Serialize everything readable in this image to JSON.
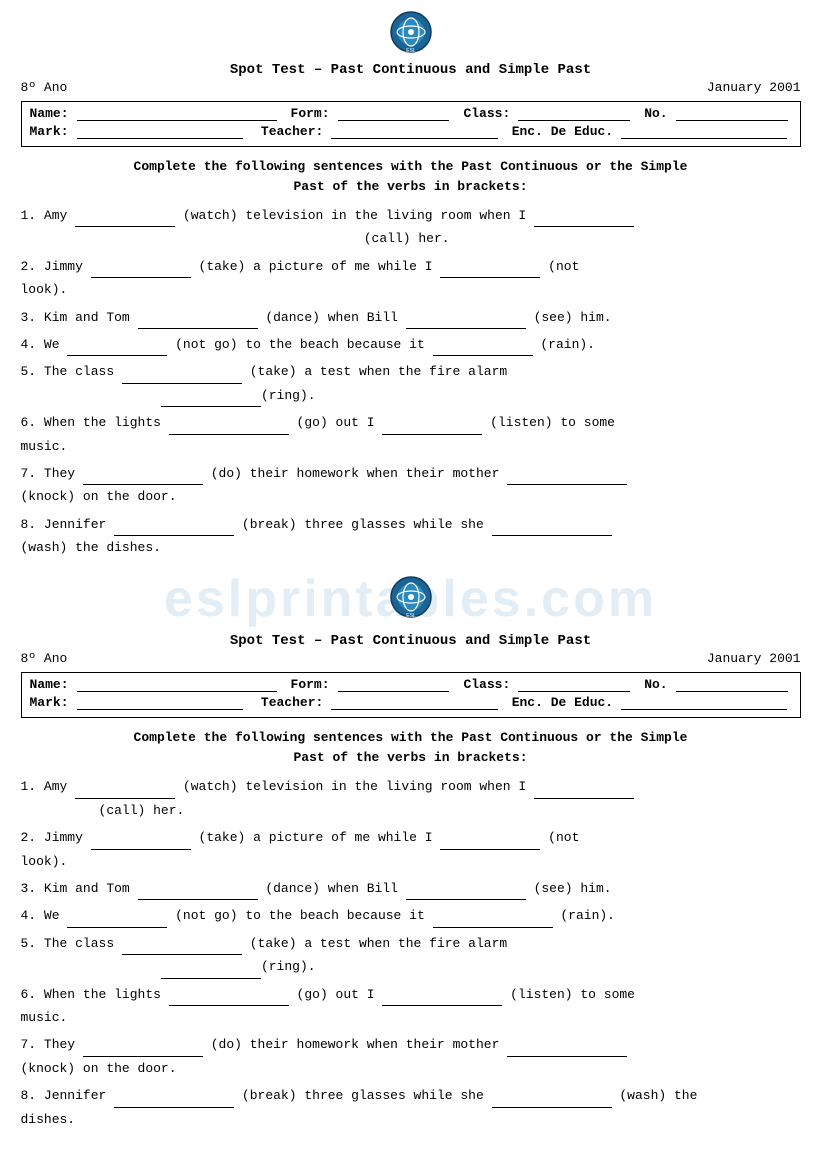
{
  "logo": {
    "alt": "ESL Printables Logo"
  },
  "section1": {
    "title": "Spot Test – Past Continuous and Simple Past",
    "grade": "8º Ano",
    "date": "January 2001",
    "form_labels": {
      "name": "Name:",
      "form": "Form:",
      "class": "Class:",
      "no": "No.",
      "mark": "Mark:",
      "teacher": "Teacher:",
      "enc": "Enc. De Educ."
    },
    "instructions": "Complete the following sentences with the Past Continuous or the Simple\nPast of the verbs in brackets:",
    "exercises": [
      {
        "num": "1.",
        "text_parts": [
          "Amy ",
          " (watch) television in the living room when I ",
          " (call) her."
        ],
        "blanks": 2
      },
      {
        "num": "2.",
        "text_parts": [
          "Jimmy ",
          " (take) a picture of me while I ",
          " (not look)."
        ],
        "blanks": 2
      },
      {
        "num": "3.",
        "text_parts": [
          "Kim and Tom ",
          " (dance) when Bill ",
          " (see) him."
        ],
        "blanks": 2
      },
      {
        "num": "4.",
        "text_parts": [
          "We ",
          " (not go) to the beach because it ",
          " (rain)."
        ],
        "blanks": 2
      },
      {
        "num": "5.",
        "text_parts": [
          "The  class ",
          " (take)  a  test  when  the  fire  alarm ",
          "(ring)."
        ],
        "blanks": 2
      },
      {
        "num": "6.",
        "text_parts": [
          "When the lights ",
          " (go) out I ",
          " (listen) to some music."
        ],
        "blanks": 2
      },
      {
        "num": "7.",
        "text_parts": [
          "They ",
          " (do) their homework when their mother ",
          " (knock) on the door."
        ],
        "blanks": 2
      },
      {
        "num": "8.",
        "text_parts": [
          "Jennifer ",
          " (break) three glasses while she ",
          " (wash) the dishes."
        ],
        "blanks": 2
      }
    ]
  },
  "section2": {
    "title": "Spot Test – Past Continuous and Simple Past",
    "grade": "8º Ano",
    "date": "January 2001",
    "instructions": "Complete the following sentences with the Past Continuous or the Simple\nPast of the verbs in brackets:",
    "exercises": [
      {
        "num": "1.",
        "text_parts": [
          "Amy ",
          " (watch) television in the living room when I ",
          " (call) her."
        ],
        "blanks": 2
      },
      {
        "num": "2.",
        "text_parts": [
          "Jimmy ",
          " (take) a picture of me while I ",
          " (not look)."
        ],
        "blanks": 2
      },
      {
        "num": "3.",
        "text_parts": [
          "Kim and Tom ",
          " (dance) when Bill ",
          " (see) him."
        ],
        "blanks": 2
      },
      {
        "num": "4.",
        "text_parts": [
          "We ",
          " (not go) to the beach because it ",
          " (rain)."
        ],
        "blanks": 2
      },
      {
        "num": "5.",
        "text_parts": [
          "The  class ",
          " (take)  a  test  when  the  fire  alarm ",
          "(ring)."
        ],
        "blanks": 2
      },
      {
        "num": "6.",
        "text_parts": [
          "When the lights ",
          " (go) out I ",
          " (listen) to some music."
        ],
        "blanks": 2
      },
      {
        "num": "7.",
        "text_parts": [
          "They ",
          " (do) their homework when their mother ",
          " (knock) on the door."
        ],
        "blanks": 2
      },
      {
        "num": "8.",
        "text_parts": [
          "Jennifer ",
          " (break) three glasses while she ",
          " (wash) the dishes."
        ],
        "blanks": 2
      }
    ]
  }
}
